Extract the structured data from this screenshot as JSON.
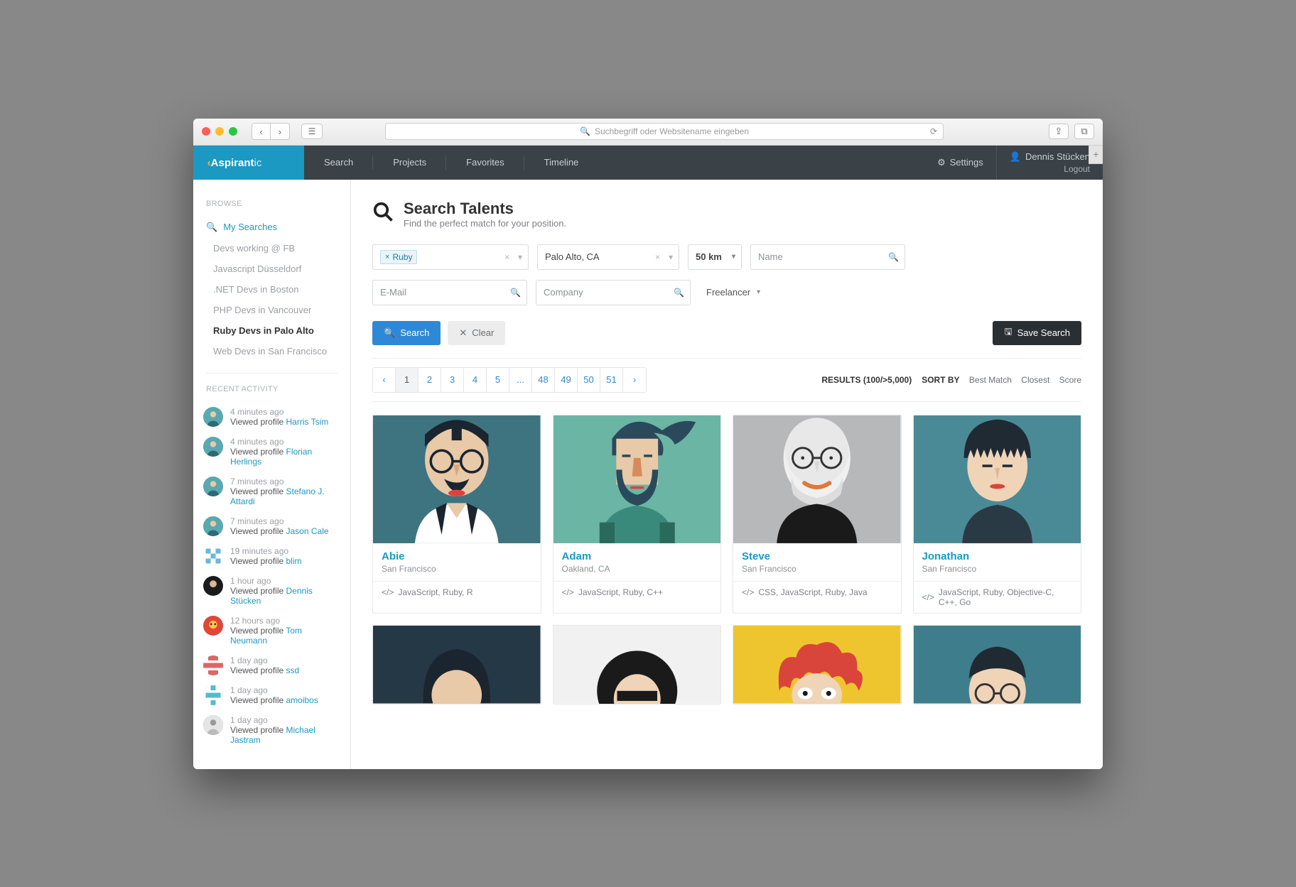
{
  "browser": {
    "url_placeholder": "Suchbegriff oder Websitename eingeben"
  },
  "brand": "Aspirantic",
  "nav": {
    "search": "Search",
    "projects": "Projects",
    "favorites": "Favorites",
    "timeline": "Timeline",
    "settings": "Settings"
  },
  "user": {
    "name": "Dennis Stücken",
    "logout": "Logout"
  },
  "sidebar": {
    "browse_header": "BROWSE",
    "my_searches": "My Searches",
    "items": [
      "Devs working @ FB",
      "Javascript Düsseldorf",
      ".NET Devs in Boston",
      "PHP Devs in Vancouver",
      "Ruby Devs in Palo Alto",
      "Web Devs in San Francisco"
    ],
    "recent_header": "RECENT ACTIVITY",
    "viewed_profile": "Viewed profile",
    "activity": [
      {
        "time": "4 minutes ago",
        "name": "Harris Tsim",
        "avatar": "teal"
      },
      {
        "time": "4 minutes ago",
        "name": "Florian Herlings",
        "avatar": "teal"
      },
      {
        "time": "7 minutes ago",
        "name": "Stefano J. Attardi",
        "avatar": "teal"
      },
      {
        "time": "7 minutes ago",
        "name": "Jason Cale",
        "avatar": "teal"
      },
      {
        "time": "19 minutes ago",
        "name": "blim",
        "avatar": "pix-blue"
      },
      {
        "time": "1 hour ago",
        "name": "Dennis Stücken",
        "avatar": "dark"
      },
      {
        "time": "12 hours ago",
        "name": "Tom Neumann",
        "avatar": "orange"
      },
      {
        "time": "1 day ago",
        "name": "ssd",
        "avatar": "pix-red"
      },
      {
        "time": "1 day ago",
        "name": "amoibos",
        "avatar": "pix-cyan"
      },
      {
        "time": "1 day ago",
        "name": "Michael Jastram",
        "avatar": "gray"
      }
    ]
  },
  "page": {
    "title": "Search Talents",
    "subtitle": "Find the perfect match for your position."
  },
  "filters": {
    "tag_label": "Ruby",
    "location_value": "Palo Alto, CA",
    "distance": "50 km",
    "name_placeholder": "Name",
    "email_placeholder": "E-Mail",
    "company_placeholder": "Company",
    "freelancer": "Freelancer"
  },
  "buttons": {
    "search": "Search",
    "clear": "Clear",
    "save": "Save Search"
  },
  "results_meta": {
    "count": "RESULTS (100/>5,000)",
    "sort_by": "SORT BY",
    "sort_opts": {
      "best": "Best Match",
      "closest": "Closest",
      "score": "Score"
    }
  },
  "pagination": [
    "1",
    "2",
    "3",
    "4",
    "5",
    "...",
    "48",
    "49",
    "50",
    "51"
  ],
  "cards": [
    {
      "name": "Abie",
      "location": "San Francisco",
      "skills": "JavaScript, Ruby, R",
      "bg": "#3e7380"
    },
    {
      "name": "Adam",
      "location": "Oakland, CA",
      "skills": "JavaScript, Ruby, C++",
      "bg": "#6bb5a5"
    },
    {
      "name": "Steve",
      "location": "San Francisco",
      "skills": "CSS, JavaScript, Ruby, Java",
      "bg": "#b7b8ba"
    },
    {
      "name": "Jonathan",
      "location": "San Francisco",
      "skills": "JavaScript, Ruby, Objective-C, C++, Go",
      "bg": "#4a8a97"
    }
  ],
  "row2_bg": [
    "#253845",
    "#f1f1f1",
    "#efc52f",
    "#3e7e8c"
  ]
}
